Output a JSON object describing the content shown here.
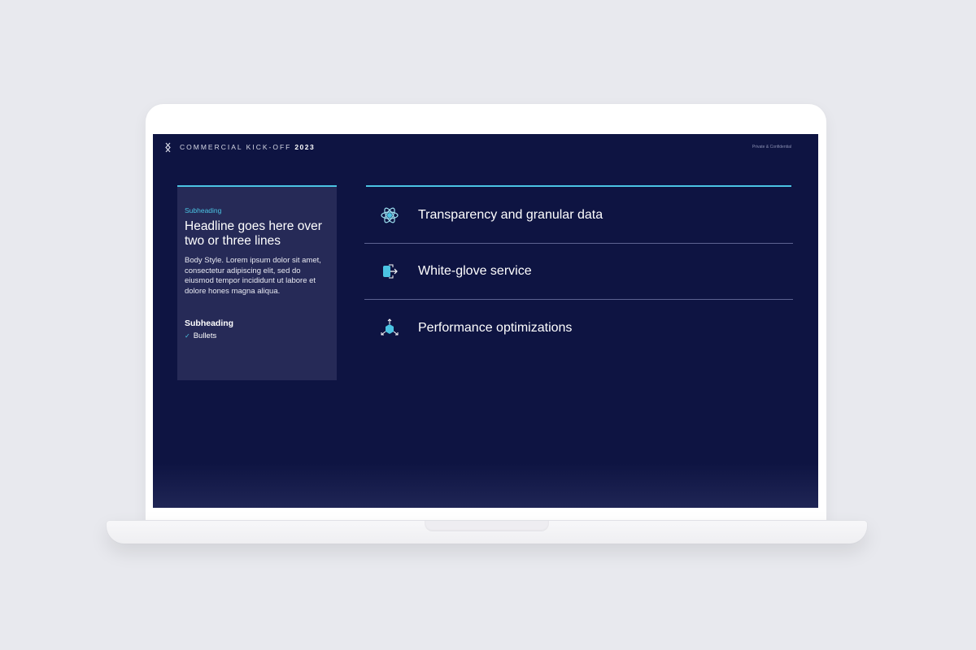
{
  "header": {
    "title": "COMMERCIAL KICK-OFF",
    "year": "2023",
    "confidential": "Private & Confidential"
  },
  "card": {
    "subheading": "Subheading",
    "headline": "Headline goes here over two or three lines",
    "body": "Body Style. Lorem ipsum dolor sit amet, consectetur adipiscing elit, sed do eiusmod tempor incididunt ut labore et dolore hones magna aliqua.",
    "subheading2": "Subheading",
    "bullet": "Bullets"
  },
  "features": [
    {
      "label": "Transparency and granular data",
      "icon": "atom-icon"
    },
    {
      "label": "White-glove service",
      "icon": "transfer-icon"
    },
    {
      "label": "Performance optimizations",
      "icon": "cube-arrows-icon"
    }
  ],
  "colors": {
    "background": "#0e1442",
    "card": "#262a57",
    "accent": "#4bc4e3"
  }
}
